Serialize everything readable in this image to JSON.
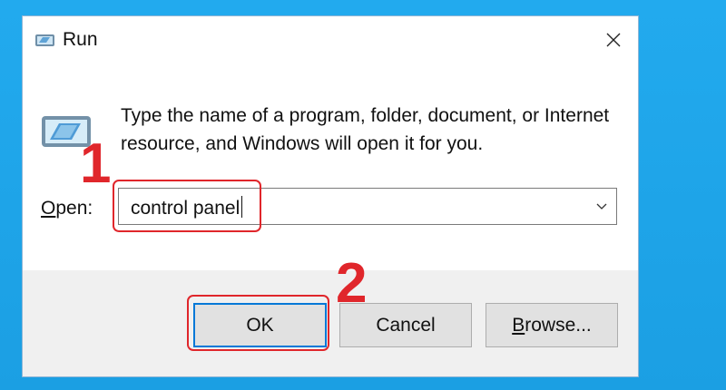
{
  "window": {
    "title": "Run",
    "title_icon": "run-icon",
    "close_icon": "close-icon"
  },
  "content": {
    "description": "Type the name of a program, folder, document, or Internet resource, and Windows will open it for you.",
    "big_icon": "run-icon"
  },
  "open_field": {
    "label_accel": "O",
    "label_rest": "pen:",
    "value": "control panel",
    "dropdown_icon": "chevron-down-icon"
  },
  "buttons": {
    "ok": "OK",
    "cancel": "Cancel",
    "browse_accel": "B",
    "browse_rest": "rowse..."
  },
  "annotations": {
    "step1": "1",
    "step2": "2",
    "color": "#e0262b"
  },
  "colors": {
    "desktop": "#1ea7ec",
    "default_button_border": "#0078d7"
  }
}
